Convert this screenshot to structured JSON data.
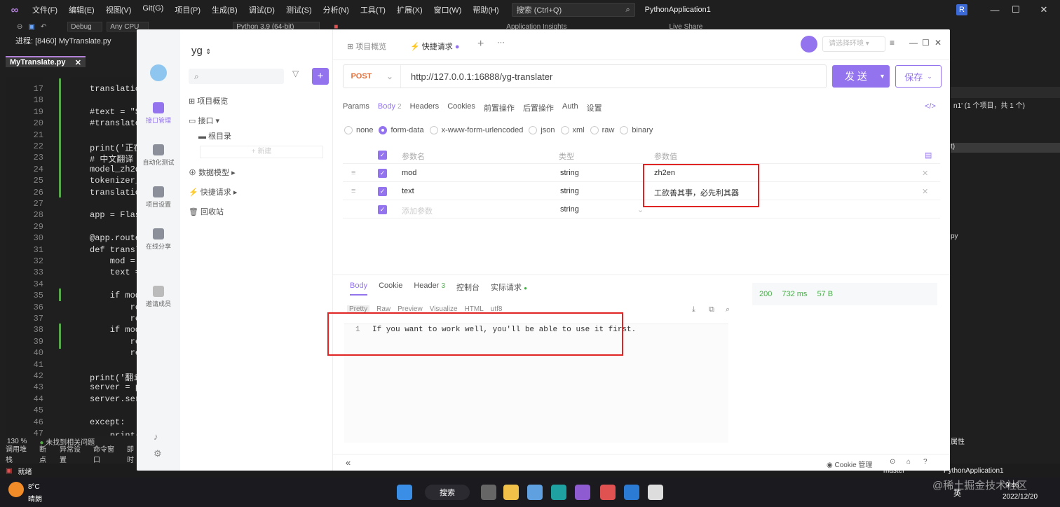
{
  "vs": {
    "menu": [
      "文件(F)",
      "编辑(E)",
      "视图(V)",
      "Git(G)",
      "项目(P)",
      "生成(B)",
      "调试(D)",
      "测试(S)",
      "分析(N)",
      "工具(T)",
      "扩展(X)",
      "窗口(W)",
      "帮助(H)"
    ],
    "search": "搜索 (Ctrl+Q)",
    "app_title": "PythonApplication1",
    "avatar": "R",
    "toolbar": {
      "config": "Debug",
      "platform": "Any CPU",
      "python": "Python 3.9 (64-bit)",
      "insights": "Application Insights",
      "live_share": "Live Share"
    },
    "process": "进程: [8460] MyTranslate.py",
    "file_tab": "MyTranslate.py",
    "line_numbers": [
      "17",
      "18",
      "19",
      "20",
      "21",
      "22",
      "23",
      "24",
      "25",
      "26",
      "27",
      "28",
      "29",
      "30",
      "31",
      "32",
      "33",
      "34",
      "35",
      "36",
      "37",
      "38",
      "39",
      "40",
      "41",
      "42",
      "43",
      "44",
      "45",
      "46",
      "47"
    ],
    "code_lines": [
      "translatio",
      "",
      "#text = \"S",
      "#translate",
      "",
      "print('正在",
      "# 中文翻译",
      "model_zh2d",
      "tokenizer_",
      "translatio",
      "",
      "app = Flas",
      "",
      "@app.route",
      "def transl",
      "    mod =",
      "    text =",
      "",
      "    if mod",
      "        re",
      "        re",
      "    if mod",
      "        re",
      "        re",
      "",
      "print('翻i",
      "server = p",
      "server.ser",
      "",
      "except:",
      "    print('翻i"
    ],
    "zoom": "130 %",
    "issues": "未找到相关问题",
    "bottom_tabs": [
      "调用堆栈",
      "断点",
      "异常设置",
      "命令窗口",
      "即时"
    ],
    "status": "就绪",
    "status_right": [
      "master",
      "PythonApplication1"
    ],
    "right_panel": [
      "n1' (1 个项目，共 1 个)",
      "t)",
      "py",
      "属性"
    ]
  },
  "taskbar": {
    "weather_temp": "8°C",
    "weather_desc": "晴朗",
    "search": "搜索",
    "ime": "英",
    "time": "9:46",
    "date": "2022/12/20",
    "watermark": "@稀土掘金技术社区"
  },
  "apifox": {
    "nav": [
      "接口管理",
      "自动化测试",
      "项目设置",
      "在线分享",
      "邀请成员"
    ],
    "project": "yg",
    "tree": [
      "项目概览",
      "接口",
      "根目录",
      "新建",
      "数据模型",
      "快捷请求",
      "回收站"
    ],
    "tabs": [
      "项目概览",
      "快捷请求"
    ],
    "env": "请选择环境",
    "method": "POST",
    "url": "http://127.0.0.1:16888/yg-translater",
    "send": "发 送",
    "save": "保存",
    "req_tabs": [
      "Params",
      "Body",
      "Headers",
      "Cookies",
      "前置操作",
      "后置操作",
      "Auth",
      "设置"
    ],
    "body_count": "2",
    "content_types": [
      "none",
      "form-data",
      "x-www-form-urlencoded",
      "json",
      "xml",
      "raw",
      "binary"
    ],
    "table_headers": [
      "参数名",
      "类型",
      "参数值"
    ],
    "params": [
      {
        "name": "mod",
        "type": "string",
        "value": "zh2en"
      },
      {
        "name": "text",
        "type": "string",
        "value": "工欲善其事，必先利其器"
      },
      {
        "name": "添加参数",
        "type": "string",
        "value": ""
      }
    ],
    "resp_tabs": [
      "Body",
      "Cookie",
      "Header",
      "控制台",
      "实际请求"
    ],
    "header_count": "3",
    "resp_sub": [
      "Pretty",
      "Raw",
      "Preview",
      "Visualize",
      "HTML",
      "utf8"
    ],
    "resp_line_no": "1",
    "resp_text": "If you want to work well, you'll be able to use it first.",
    "status_code": "200",
    "time": "732 ms",
    "size": "57 B",
    "cookie_mgmt": "Cookie 管理"
  },
  "colors": {
    "accent": "#9373ee",
    "method": "#e3703a",
    "highlight": "#e02424",
    "success": "#4cae4c"
  }
}
